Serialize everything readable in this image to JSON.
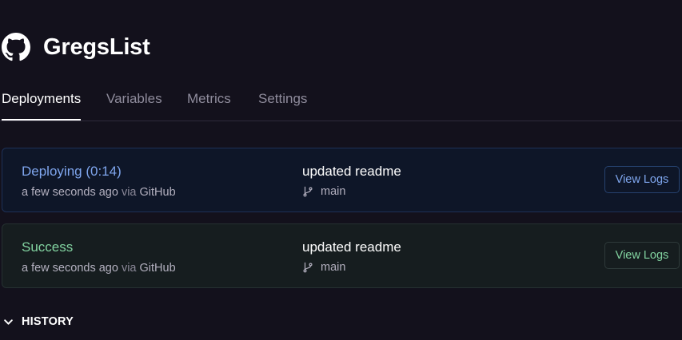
{
  "project": {
    "title": "GregsList",
    "icon": "github-icon"
  },
  "tabs": [
    {
      "label": "Deployments",
      "active": true
    },
    {
      "label": "Variables",
      "active": false
    },
    {
      "label": "Metrics",
      "active": false
    },
    {
      "label": "Settings",
      "active": false
    }
  ],
  "deployments": [
    {
      "status": "Deploying (0:14)",
      "time": "a few seconds ago",
      "via": "via",
      "source": "GitHub",
      "commit_message": "updated readme",
      "branch": "main",
      "button": "View Logs",
      "accent_color": "#7fa6ee"
    },
    {
      "status": "Success",
      "time": "a few seconds ago",
      "via": "via",
      "source": "GitHub",
      "commit_message": "updated readme",
      "branch": "main",
      "button": "View Logs",
      "accent_color": "#82d3a0"
    }
  ],
  "history": {
    "label": "HISTORY",
    "icon": "chevron-down-icon"
  }
}
